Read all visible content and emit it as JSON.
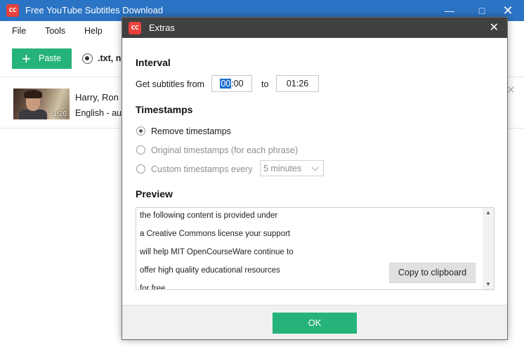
{
  "main": {
    "title": "Free YouTube Subtitles Download",
    "icon_text": "CC",
    "menu": [
      "File",
      "Tools",
      "Help"
    ],
    "toolbar": {
      "paste_label": "Paste",
      "format_label": ".txt, n"
    },
    "video": {
      "title": "Harry, Ron",
      "subtitle": "English - aut",
      "duration": "1:26"
    }
  },
  "dialog": {
    "title": "Extras",
    "icon_text": "CC",
    "interval": {
      "heading": "Interval",
      "from_label": "Get subtitles from",
      "from_sel": "00",
      "from_rest": ":00",
      "to_label": "to",
      "to_value": "01:26"
    },
    "timestamps": {
      "heading": "Timestamps",
      "options": [
        {
          "label": "Remove timestamps",
          "checked": true,
          "enabled": true
        },
        {
          "label": "Original timestamps (for each phrase)",
          "checked": false,
          "enabled": false
        },
        {
          "label": "Custom timestamps every",
          "checked": false,
          "enabled": false
        }
      ],
      "interval_select": "5 minutes"
    },
    "preview": {
      "heading": "Preview",
      "lines": [
        "the following content is provided under",
        "a Creative Commons license your support",
        "will help MIT OpenCourseWare continue to",
        "offer high quality educational resources",
        "for free"
      ],
      "copy_label": "Copy to clipboard"
    },
    "ok_label": "OK"
  },
  "colors": {
    "titlebar": "#2b73c4",
    "dialog_titlebar": "#404040",
    "accent_green": "#26b37a",
    "icon_red": "#e8403b"
  }
}
